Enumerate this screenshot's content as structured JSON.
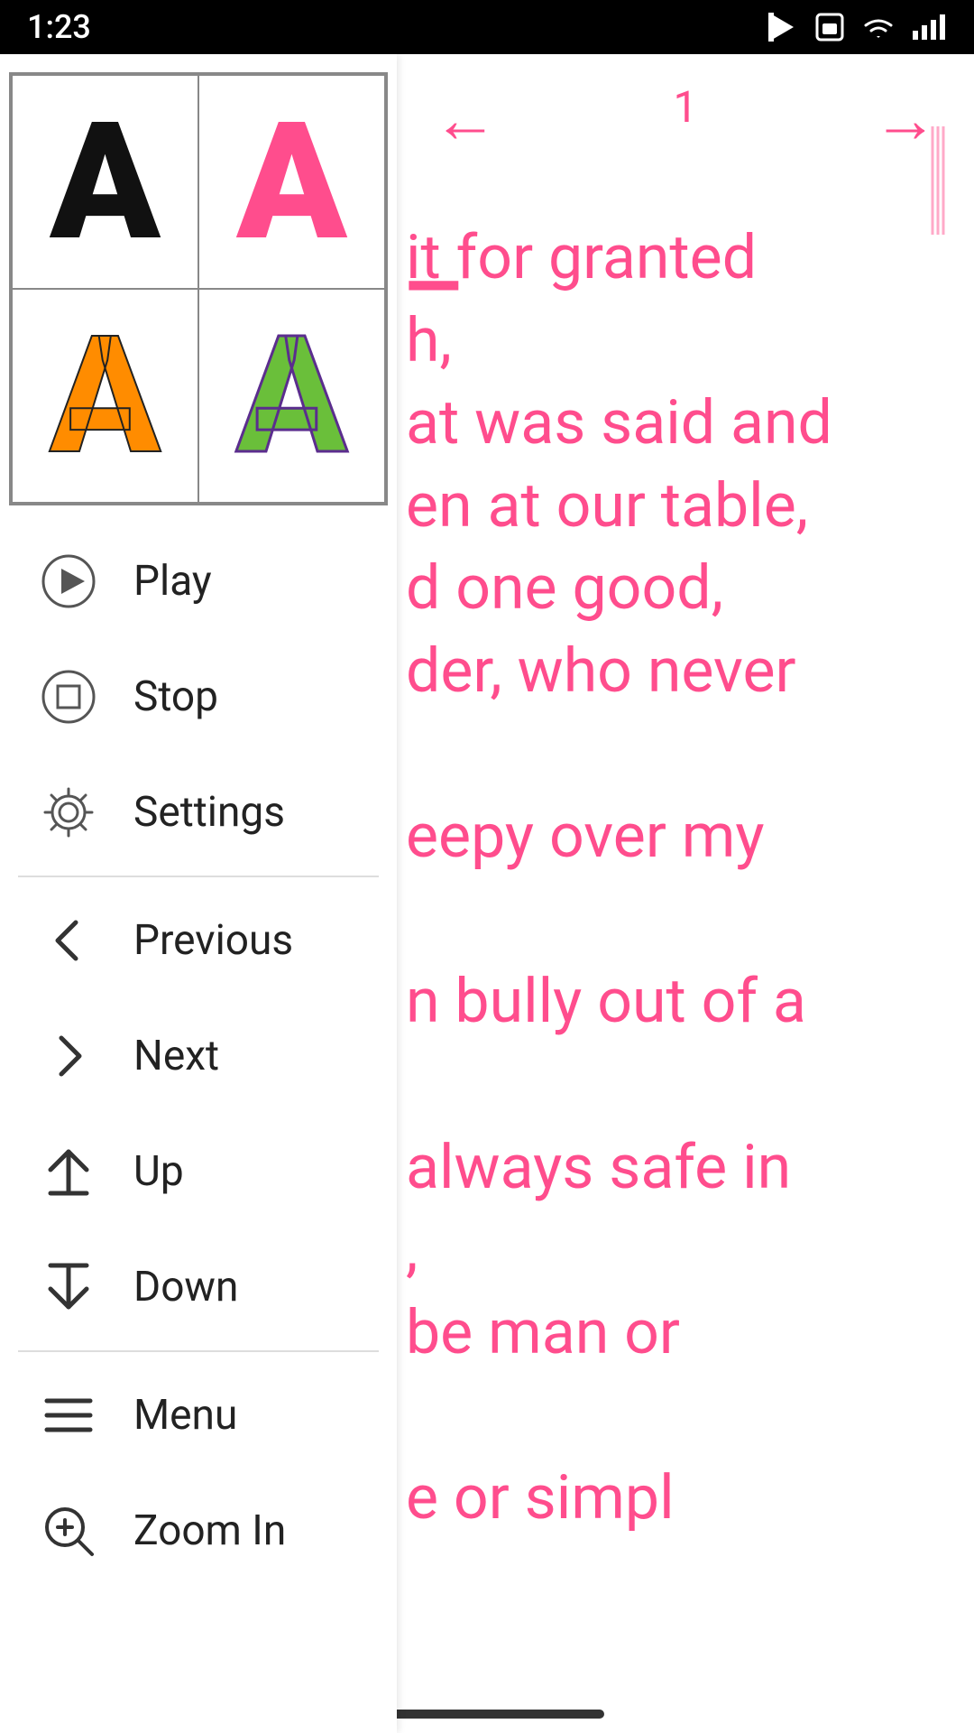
{
  "statusBar": {
    "time": "1:23",
    "icons": [
      "play-store",
      "sim",
      "wifi",
      "signal"
    ]
  },
  "fontGrid": {
    "cells": [
      {
        "letter": "A",
        "style": "black"
      },
      {
        "letter": "A",
        "style": "pink"
      },
      {
        "letter": "A",
        "style": "orange"
      },
      {
        "letter": "A",
        "style": "green-purple"
      }
    ]
  },
  "menuItems": [
    {
      "id": "play",
      "label": "Play",
      "icon": "play-icon",
      "dividerAfter": false
    },
    {
      "id": "stop",
      "label": "Stop",
      "icon": "stop-icon",
      "dividerAfter": false
    },
    {
      "id": "settings",
      "label": "Settings",
      "icon": "settings-icon",
      "dividerAfter": true
    },
    {
      "id": "previous",
      "label": "Previous",
      "icon": "arrow-left-icon",
      "dividerAfter": false
    },
    {
      "id": "next",
      "label": "Next",
      "icon": "arrow-right-icon",
      "dividerAfter": false
    },
    {
      "id": "up",
      "label": "Up",
      "icon": "arrow-up-icon",
      "dividerAfter": false
    },
    {
      "id": "down",
      "label": "Down",
      "icon": "arrow-down-icon",
      "dividerAfter": true
    },
    {
      "id": "menu",
      "label": "Menu",
      "icon": "menu-icon",
      "dividerAfter": false
    },
    {
      "id": "zoom-in",
      "label": "Zoom In",
      "icon": "zoom-in-icon",
      "dividerAfter": false
    }
  ],
  "rightPanel": {
    "pageNumber": "1",
    "backArrow": "←",
    "forwardArrow": "→",
    "contentLines": [
      "it for granted",
      "h,",
      "at was said and",
      "en at our table,",
      "d one good,",
      "der, who never",
      "",
      "eepy over my",
      "",
      "n bully out of a",
      "",
      "always safe in",
      ",",
      "be man or",
      "",
      "e or simpl"
    ]
  }
}
